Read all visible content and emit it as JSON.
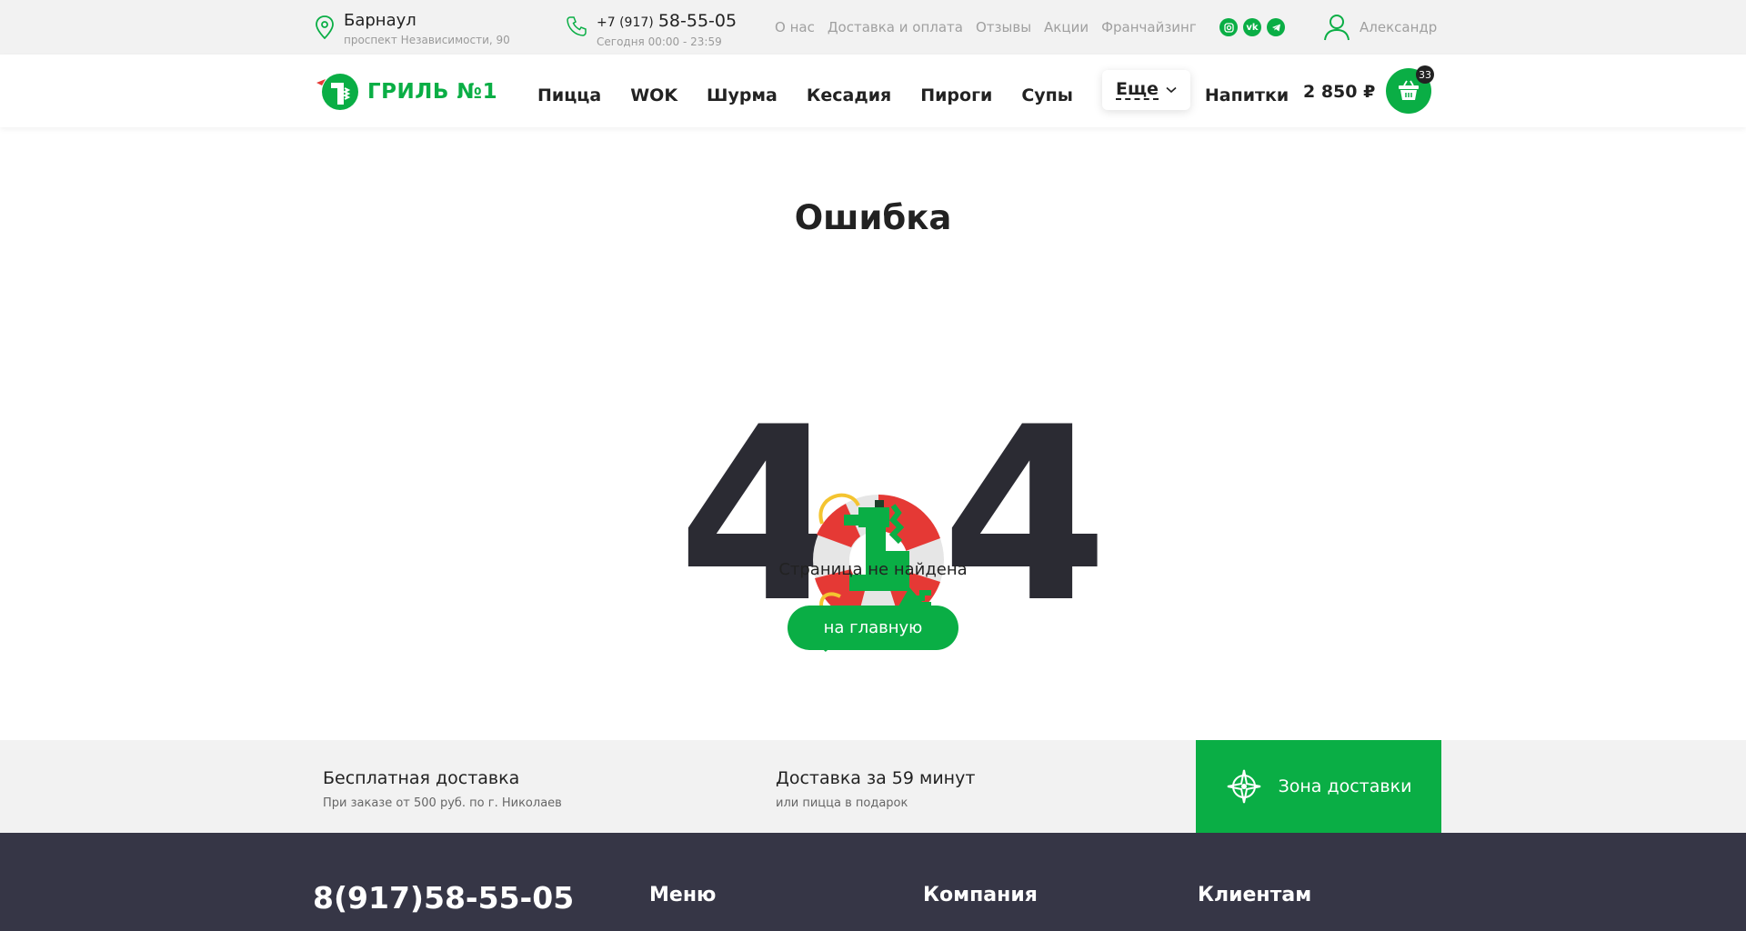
{
  "topbar": {
    "city": "Барнаул",
    "address": "проспект Независимости, 90",
    "phone_prefix": "+7 (917)",
    "phone_main": "58-55-05",
    "hours": "Сегодня 00:00 - 23:59",
    "links": [
      "О нас",
      "Доставка и оплата",
      "Отзывы",
      "Акции",
      "Франчайзинг"
    ],
    "socials": [
      "instagram-icon",
      "vk-icon",
      "telegram-icon"
    ],
    "user_name": "Александр"
  },
  "header": {
    "logo_text": "ГРИЛЬ №1",
    "nav": [
      "Пицца",
      "WOK",
      "Шурма",
      "Кесадия",
      "Пироги",
      "Супы"
    ],
    "more_label": "Еще",
    "last_nav": "Напитки",
    "cart_total": "2 850 ₽",
    "cart_count": "33"
  },
  "main": {
    "title": "Ошибка",
    "code_left": "4",
    "code_right": "4",
    "message": "Страница не найдена",
    "button": "на главную"
  },
  "strip": {
    "item1_title": "Бесплатная доставка",
    "item1_sub": "При заказе от 500 руб. по г. Николаев",
    "item2_title": "Доставка за 59 минут",
    "item2_sub": "или пицца в подарок",
    "zone_label": "Зона доставки"
  },
  "footer": {
    "phone": "8(917)58-55-05",
    "columns": [
      "Меню",
      "Компания",
      "Клиентам"
    ]
  },
  "colors": {
    "brand_green": "#0aae45",
    "dark": "#2b2b33",
    "footer_bg": "#363646",
    "topbar_bg": "#f2f2f2"
  }
}
